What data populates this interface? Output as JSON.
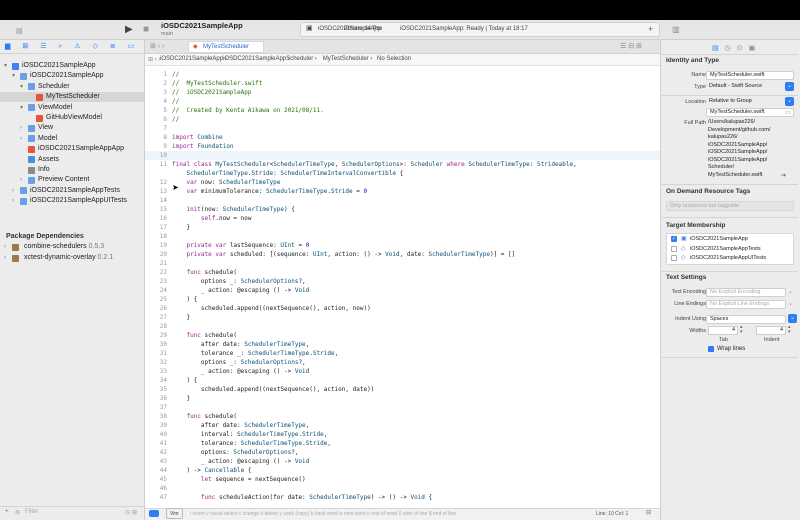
{
  "window": {
    "project": "iOSDC2021SampleApp",
    "branch": "main",
    "device": "iPhone 14 Pro",
    "status": "iOSDC2021SampleApp: Ready | Today at 18:17"
  },
  "tab": {
    "label": "MyTestScheduler"
  },
  "jumpbar": [
    "iOSDC2021SampleApp",
    "iOSDC2021SampleApp",
    "Scheduler",
    "MyTestScheduler",
    "No Selection"
  ],
  "navigator": {
    "rows": [
      {
        "label": "iOSDC2021SampleApp",
        "indent": 0,
        "kind": "project"
      },
      {
        "label": "iOSDC2021SampleApp",
        "indent": 1,
        "kind": "folder"
      },
      {
        "label": "Scheduler",
        "indent": 2,
        "kind": "folder"
      },
      {
        "label": "MyTestScheduler",
        "indent": 3,
        "kind": "swift",
        "selected": true
      },
      {
        "label": "ViewModel",
        "indent": 2,
        "kind": "folder"
      },
      {
        "label": "GitHubViewModel",
        "indent": 3,
        "kind": "swift"
      },
      {
        "label": "View",
        "indent": 2,
        "kind": "folder"
      },
      {
        "label": "Model",
        "indent": 2,
        "kind": "folder"
      },
      {
        "label": "iOSDC2021SampleAppApp",
        "indent": 2,
        "kind": "swift"
      },
      {
        "label": "Assets",
        "indent": 2,
        "kind": "assets"
      },
      {
        "label": "Info",
        "indent": 2,
        "kind": "plist"
      },
      {
        "label": "Preview Content",
        "indent": 2,
        "kind": "folder"
      },
      {
        "label": "iOSDC2021SampleAppTests",
        "indent": 1,
        "kind": "folder"
      },
      {
        "label": "iOSDC2021SampleAppUITests",
        "indent": 1,
        "kind": "folder"
      }
    ],
    "deps_header": "Package Dependencies",
    "deps": [
      {
        "name": "combine-schedulers",
        "version": "0.5.3"
      },
      {
        "name": "xctest-dynamic-overlay",
        "version": "0.2.1"
      }
    ],
    "filter_placeholder": "Filter"
  },
  "code": [
    {
      "n": "1",
      "t": "//"
    },
    {
      "n": "2",
      "t": "//  MyTestScheduler.swift"
    },
    {
      "n": "3",
      "t": "//  iOSDC2021SampleApp"
    },
    {
      "n": "4",
      "t": "//"
    },
    {
      "n": "5",
      "t": "//  Created by Kenta Aikawa on 2021/08/11."
    },
    {
      "n": "6",
      "t": "//"
    },
    {
      "n": "7",
      "t": ""
    },
    {
      "n": "8",
      "t": "import Combine"
    },
    {
      "n": "9",
      "t": "import Foundation"
    },
    {
      "n": "10",
      "t": ""
    },
    {
      "n": "11",
      "t": "final class MyTestScheduler<SchedulerTimeType, SchedulerOptions>: Scheduler where SchedulerTimeType: Strideable,"
    },
    {
      "n": "",
      "t": "    SchedulerTimeType.Stride: SchedulerTimeIntervalConvertible {"
    },
    {
      "n": "12",
      "t": "    var now: SchedulerTimeType"
    },
    {
      "n": "13",
      "t": "    var minimumTolerance: SchedulerTimeType.Stride = 0"
    },
    {
      "n": "14",
      "t": ""
    },
    {
      "n": "15",
      "t": "    init(now: SchedulerTimeType) {"
    },
    {
      "n": "16",
      "t": "        self.now = now"
    },
    {
      "n": "17",
      "t": "    }"
    },
    {
      "n": "18",
      "t": ""
    },
    {
      "n": "19",
      "t": "    private var lastSequence: UInt = 0"
    },
    {
      "n": "20",
      "t": "    private var scheduled: [(sequence: UInt, action: () -> Void, date: SchedulerTimeType)] = []"
    },
    {
      "n": "21",
      "t": ""
    },
    {
      "n": "22",
      "t": "    func schedule("
    },
    {
      "n": "23",
      "t": "        options _: SchedulerOptions?,"
    },
    {
      "n": "24",
      "t": "        _ action: @escaping () -> Void"
    },
    {
      "n": "25",
      "t": "    ) {"
    },
    {
      "n": "26",
      "t": "        scheduled.append((nextSequence(), action, now))"
    },
    {
      "n": "27",
      "t": "    }"
    },
    {
      "n": "28",
      "t": ""
    },
    {
      "n": "29",
      "t": "    func schedule("
    },
    {
      "n": "30",
      "t": "        after date: SchedulerTimeType,"
    },
    {
      "n": "31",
      "t": "        tolerance _: SchedulerTimeType.Stride,"
    },
    {
      "n": "32",
      "t": "        options _: SchedulerOptions?,"
    },
    {
      "n": "33",
      "t": "        _ action: @escaping () -> Void"
    },
    {
      "n": "34",
      "t": "    ) {"
    },
    {
      "n": "35",
      "t": "        scheduled.append((nextSequence(), action, date))"
    },
    {
      "n": "36",
      "t": "    }"
    },
    {
      "n": "37",
      "t": ""
    },
    {
      "n": "38",
      "t": "    func schedule("
    },
    {
      "n": "39",
      "t": "        after date: SchedulerTimeType,"
    },
    {
      "n": "40",
      "t": "        interval: SchedulerTimeType.Stride,"
    },
    {
      "n": "41",
      "t": "        tolerance: SchedulerTimeType.Stride,"
    },
    {
      "n": "42",
      "t": "        options: SchedulerOptions?,"
    },
    {
      "n": "43",
      "t": "        _ action: @escaping () -> Void"
    },
    {
      "n": "44",
      "t": "    ) -> Cancellable {"
    },
    {
      "n": "45",
      "t": "        let sequence = nextSequence()"
    },
    {
      "n": "46",
      "t": ""
    },
    {
      "n": "47",
      "t": "        func scheduleAction(for date: SchedulerTimeType) -> () -> Void {"
    }
  ],
  "current_line": "10",
  "statusbar": {
    "mode": "Vim",
    "hints": "i insert  v visual select  c change  d delete  y yank (copy)  b back word  w next word  e end of word  0 start of line  $ end of line",
    "position": "Line: 10  Col: 1"
  },
  "inspector": {
    "identity_header": "Identity and Type",
    "name_label": "Name",
    "name_value": "MyTestScheduler.swift",
    "type_label": "Type",
    "type_value": "Default - Swift Source",
    "location_label": "Location",
    "location_value": "Relative to Group",
    "location_file": "MyTestScheduler.swift",
    "fullpath_label": "Full Path",
    "fullpath_lines": [
      "/Users/kalupas226/",
      "Development/github.com/",
      "kalupas226/",
      "iOSDC2021SampleApp/",
      "iOSDC2021SampleApp/",
      "iOSDC2021SampleApp/",
      "Scheduler/",
      "MyTestScheduler.swift"
    ],
    "odr_header": "On Demand Resource Tags",
    "odr_placeholder": "Only resources are taggable",
    "target_header": "Target Membership",
    "targets": [
      {
        "name": "iOSDC2021SampleApp",
        "checked": true
      },
      {
        "name": "iOSDC2021SampleAppTests",
        "checked": false
      },
      {
        "name": "iOSDC2021SampleAppUITests",
        "checked": false
      }
    ],
    "text_header": "Text Settings",
    "encoding_label": "Text Encoding",
    "encoding_value": "No Explicit Encoding",
    "endings_label": "Line Endings",
    "endings_value": "No Explicit Line Endings",
    "indent_label": "Indent Using",
    "indent_value": "Spaces",
    "widths_label": "Widths",
    "tab_width": "4",
    "indent_width": "4",
    "tab_label": "Tab",
    "indent_sub_label": "Indent",
    "wrap_label": "Wrap lines"
  }
}
